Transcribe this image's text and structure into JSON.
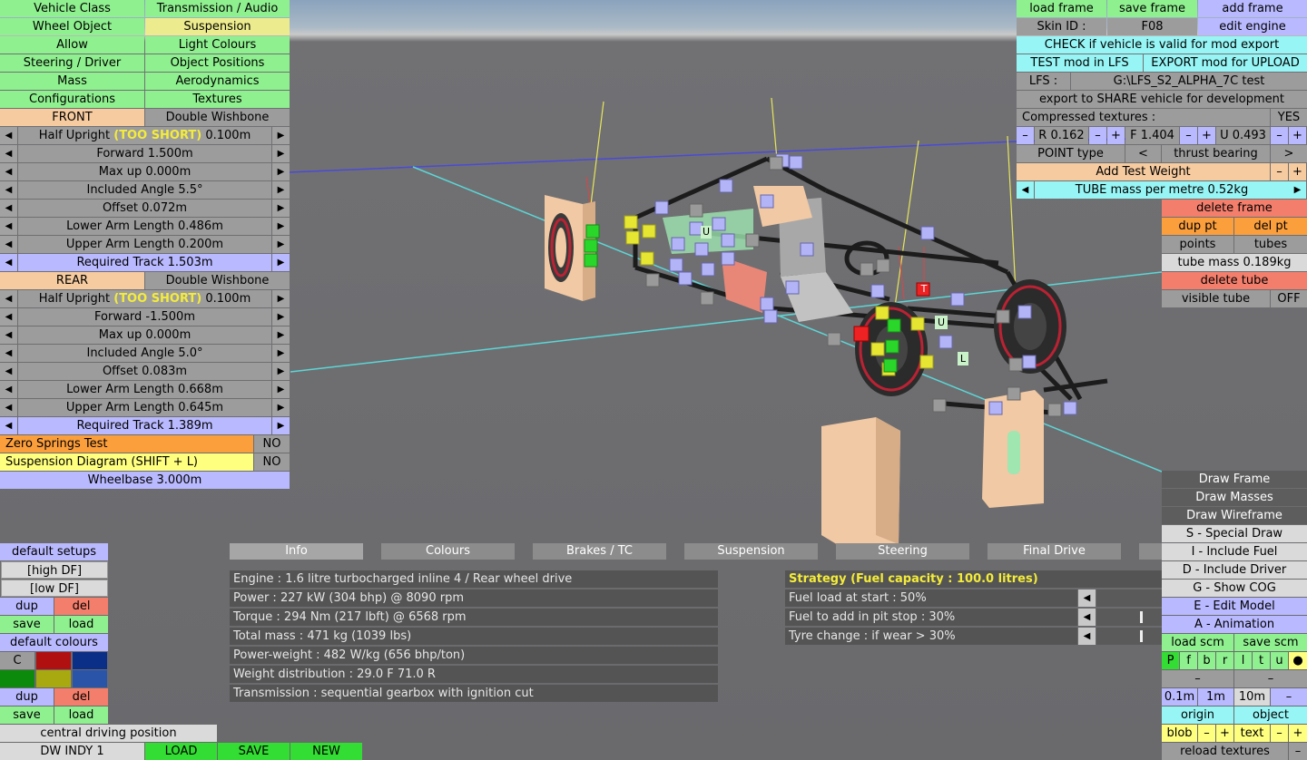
{
  "left_menu": {
    "vehicle_class": "Vehicle Class",
    "transmission_audio": "Transmission / Audio",
    "wheel_object": "Wheel Object",
    "suspension": "Suspension",
    "allow": "Allow",
    "light_colours": "Light Colours",
    "steering_driver": "Steering / Driver",
    "object_positions": "Object Positions",
    "mass": "Mass",
    "aerodynamics": "Aerodynamics",
    "configurations": "Configurations",
    "textures": "Textures"
  },
  "front": {
    "label": "FRONT",
    "type": "Double Wishbone",
    "half_upright_label": "Half Upright",
    "half_upright_warning": "(TOO SHORT)",
    "half_upright_value": "0.100m",
    "forward": "Forward 1.500m",
    "max_up": "Max up 0.000m",
    "included_angle": "Included Angle 5.5°",
    "offset": "Offset 0.072m",
    "lower_arm": "Lower Arm Length 0.486m",
    "upper_arm": "Upper Arm Length 0.200m",
    "required_track": "Required Track 1.503m"
  },
  "rear": {
    "label": "REAR",
    "type": "Double Wishbone",
    "half_upright_label": "Half Upright",
    "half_upright_warning": "(TOO SHORT)",
    "half_upright_value": "0.100m",
    "forward": "Forward -1.500m",
    "max_up": "Max up 0.000m",
    "included_angle": "Included Angle 5.0°",
    "offset": "Offset 0.083m",
    "lower_arm": "Lower Arm Length 0.668m",
    "upper_arm": "Upper Arm Length 0.645m",
    "required_track": "Required Track 1.389m"
  },
  "tests": {
    "zero_springs": "Zero Springs Test",
    "zero_springs_value": "NO",
    "susp_diagram": "Suspension Diagram (SHIFT + L)",
    "susp_diagram_value": "NO",
    "wheelbase": "Wheelbase 3.000m"
  },
  "setups": {
    "default_setups": "default setups",
    "high_df": "[high DF]",
    "low_df": "[low DF]",
    "dup": "dup",
    "del": "del",
    "save": "save",
    "load": "load",
    "default_colours": "default colours",
    "c": "C",
    "swatches": [
      "#b01010",
      "#0b2f86",
      "#0c8a0c",
      "#a8a810",
      "#2a54a8"
    ]
  },
  "bottom_left": {
    "central_driving": "central driving position",
    "car_name": "DW INDY 1",
    "load": "LOAD",
    "save": "SAVE",
    "new": "NEW"
  },
  "tabs": [
    "Info",
    "Colours",
    "Brakes / TC",
    "Suspension",
    "Steering",
    "Final Drive"
  ],
  "info": [
    "Engine : 1.6 litre turbocharged inline 4 / Rear wheel drive",
    "Power : 227 kW (304 bhp) @ 8090 rpm",
    "Torque : 294 Nm (217 lbft) @ 6568 rpm",
    "Total mass : 471 kg (1039 lbs)",
    "Power-weight : 482 W/kg (656 bhp/ton)",
    "Weight distribution : 29.0 F  71.0 R",
    "Transmission : sequential gearbox with ignition cut"
  ],
  "strategy": {
    "title": "Strategy (Fuel capacity : 100.0 litres)",
    "fuel_start": "Fuel load at start : 50%",
    "fuel_pit": "Fuel to add in pit stop : 30%",
    "tyre_change": "Tyre change : if wear > 30%",
    "fuel_pit_level": 0.3,
    "tyre_level": 0.3
  },
  "top_right": {
    "load_frame": "load frame",
    "save_frame": "save frame",
    "add_frame": "add frame",
    "skin_id_label": "Skin ID :",
    "skin_id": "F08",
    "edit_engine": "edit engine",
    "check_valid": "CHECK if vehicle is valid for mod export",
    "test_mod": "TEST mod in LFS",
    "export_mod": "EXPORT mod for UPLOAD",
    "lfs_label": "LFS :",
    "lfs_path": "G:\\LFS_S2_ALPHA_7C test",
    "export_share": "export to SHARE vehicle for development",
    "compressed": "Compressed textures :",
    "compressed_value": "YES",
    "r_value": "R 0.162",
    "f_value": "F 1.404",
    "u_value": "U 0.493",
    "point_type": "POINT type",
    "thrust_bearing": "thrust bearing",
    "add_test_weight": "Add Test Weight",
    "tube_mass": "TUBE mass per metre 0.52kg"
  },
  "right_tools": {
    "delete_frame": "delete frame",
    "dup_pt": "dup pt",
    "del_pt": "del pt",
    "points": "points",
    "tubes": "tubes",
    "tube_mass": "tube mass 0.189kg",
    "delete_tube": "delete tube",
    "visible_tube": "visible tube",
    "visible_tube_value": "OFF"
  },
  "draw_panel": {
    "draw_frame": "Draw Frame",
    "draw_masses": "Draw Masses",
    "draw_wireframe": "Draw Wireframe",
    "special_draw": "S - Special Draw",
    "include_fuel": "I - Include Fuel",
    "include_driver": "D - Include Driver",
    "show_cog": "G - Show COG",
    "edit_model": "E - Edit Model",
    "animation": "A - Animation",
    "load_scm": "load scm",
    "save_scm": "save scm",
    "letters": [
      "P",
      "f",
      "b",
      "r",
      "l",
      "t",
      "u"
    ],
    "dash": "–",
    "step_01": "0.1m",
    "step_1": "1m",
    "step_10": "10m",
    "origin": "origin",
    "object": "object",
    "blob": "blob",
    "text": "text",
    "reload": "reload textures"
  },
  "viewport_labels": {
    "u": "U",
    "l": "L",
    "t": "T"
  }
}
